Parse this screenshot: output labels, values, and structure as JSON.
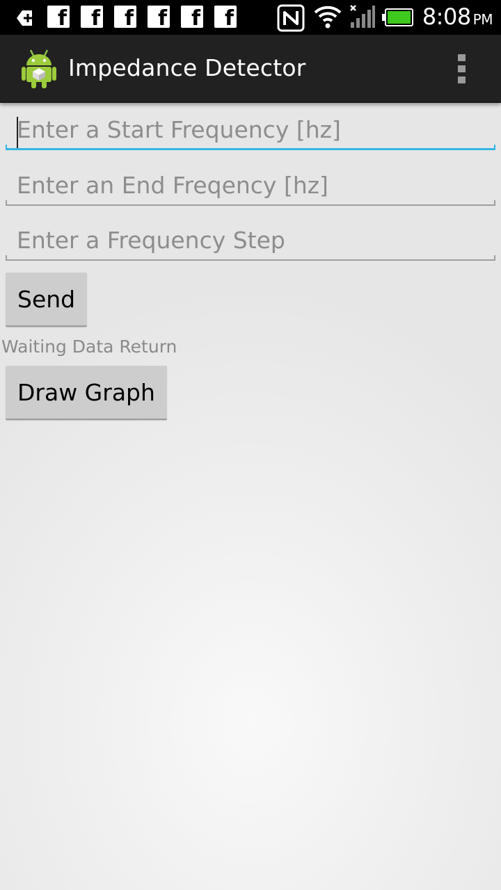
{
  "status_bar": {
    "time": "8:08",
    "ampm": "PM",
    "notification_icons": [
      "back-arrow-icon",
      "facebook-icon",
      "facebook-icon",
      "facebook-icon",
      "facebook-icon",
      "facebook-icon",
      "facebook-icon"
    ],
    "system_icons": [
      "nfc-icon",
      "wifi-icon",
      "signal-icon",
      "battery-icon"
    ],
    "battery_color": "#3fc81e"
  },
  "action_bar": {
    "title": "Impedance Detector",
    "app_icon": "android-icon",
    "overflow_icon": "overflow-menu-icon"
  },
  "form": {
    "start_frequency": {
      "value": "",
      "placeholder": "Enter a Start Frequency [hz]"
    },
    "end_frequency": {
      "value": "",
      "placeholder": "Enter an End Freqency [hz]"
    },
    "frequency_step": {
      "value": "",
      "placeholder": "Enter a Frequency Step"
    },
    "send_label": "Send",
    "status_text": "Waiting Data Return",
    "draw_graph_label": "Draw Graph"
  },
  "colors": {
    "focus_accent": "#33b5e5",
    "action_bar_bg": "#212121",
    "status_bar_bg": "#000000",
    "button_bg": "#cdcdcd"
  }
}
